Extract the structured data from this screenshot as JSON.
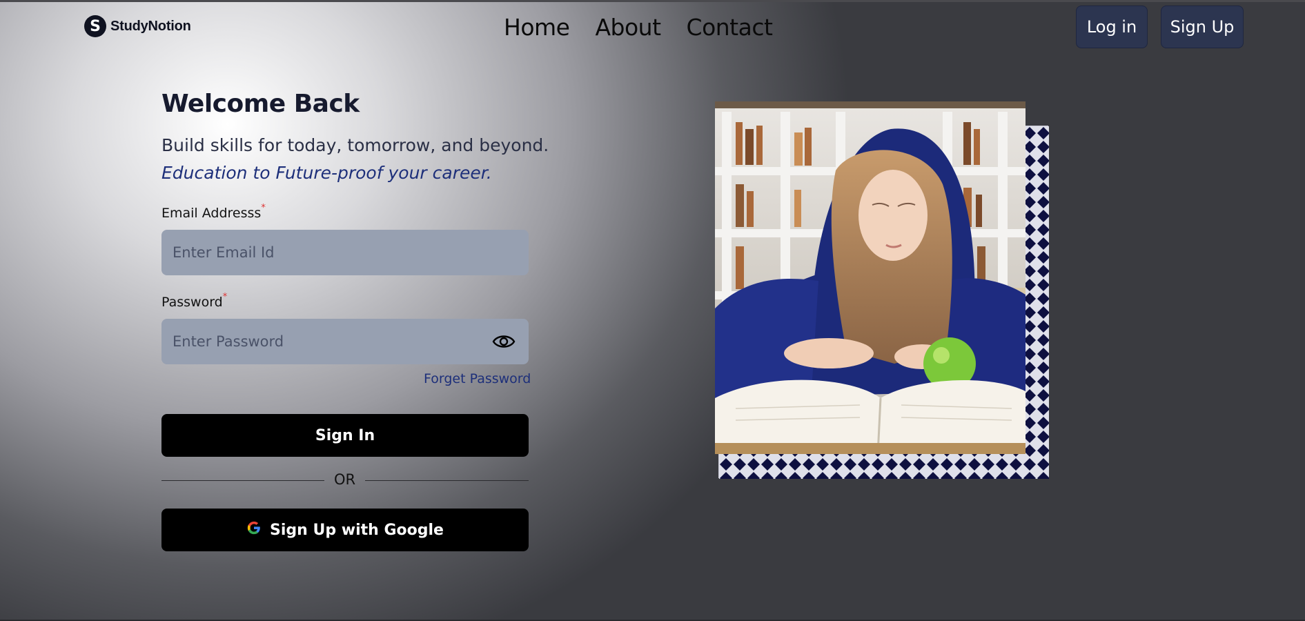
{
  "navbar": {
    "logo_text": "StudyNotion",
    "links": [
      "Home",
      "About",
      "Contact"
    ],
    "login_label": "Log in",
    "signup_label": "Sign Up"
  },
  "login": {
    "heading": "Welcome Back",
    "subtitle": "Build skills for today, tomorrow, and beyond.",
    "tagline": "Education to Future-proof your career.",
    "email_label": "Email Addresss",
    "email_placeholder": "Enter Email Id",
    "password_label": "Password",
    "password_placeholder": "Enter Password",
    "required_mark": "*",
    "forget_label": "Forget Password",
    "signin_label": "Sign In",
    "or_label": "OR",
    "google_label": "Sign Up with Google"
  },
  "icons": {
    "logo": "logo-icon",
    "password_toggle": "eye-icon",
    "google": "google-icon"
  },
  "colors": {
    "button_dark": "#2c3550",
    "input_bg": "#97a0b1",
    "accent_link": "#1d2f7a",
    "pattern": "#0e1040",
    "required": "#dd3333"
  }
}
